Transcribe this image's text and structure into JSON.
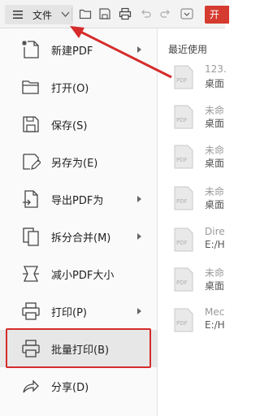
{
  "toolbar": {
    "file_label": "文件",
    "open_badge": "开",
    "icons": [
      "menu-icon",
      "chevron-down-icon",
      "open-folder-icon",
      "save-icon",
      "print-icon",
      "undo-icon",
      "redo-icon",
      "more-dropdown-icon"
    ]
  },
  "menu": {
    "items": [
      {
        "label": "新建PDF",
        "icon": "new-pdf-icon",
        "has_submenu": true
      },
      {
        "label": "打开(O)",
        "icon": "open-folder-icon",
        "has_submenu": false
      },
      {
        "label": "保存(S)",
        "icon": "save-icon",
        "has_submenu": false
      },
      {
        "label": "另存为(E)",
        "icon": "save-as-icon",
        "has_submenu": false
      },
      {
        "label": "导出PDF为",
        "icon": "export-pdf-icon",
        "has_submenu": true
      },
      {
        "label": "拆分合并(M)",
        "icon": "split-merge-icon",
        "has_submenu": true
      },
      {
        "label": "减小PDF大小",
        "icon": "compress-icon",
        "has_submenu": false
      },
      {
        "label": "打印(P)",
        "icon": "print-icon",
        "has_submenu": true
      },
      {
        "label": "批量打印(B)",
        "icon": "batch-print-icon",
        "has_submenu": false,
        "highlighted": true
      },
      {
        "label": "分享(D)",
        "icon": "share-icon",
        "has_submenu": false
      }
    ]
  },
  "recent": {
    "header": "最近使用",
    "items": [
      {
        "name": "123.",
        "location": "桌面"
      },
      {
        "name": "未命",
        "location": "桌面"
      },
      {
        "name": "未命",
        "location": "桌面"
      },
      {
        "name": "未命",
        "location": "桌面"
      },
      {
        "name": "Dire",
        "location": "E:/H"
      },
      {
        "name": "未命",
        "location": "桌面"
      },
      {
        "name": "Mec",
        "location": "E:/H"
      }
    ]
  },
  "colors": {
    "accent_red": "#d62b2b",
    "badge_red": "#d63b30",
    "menu_bg": "#fafafa",
    "highlight_bg": "#e7e7e7"
  }
}
